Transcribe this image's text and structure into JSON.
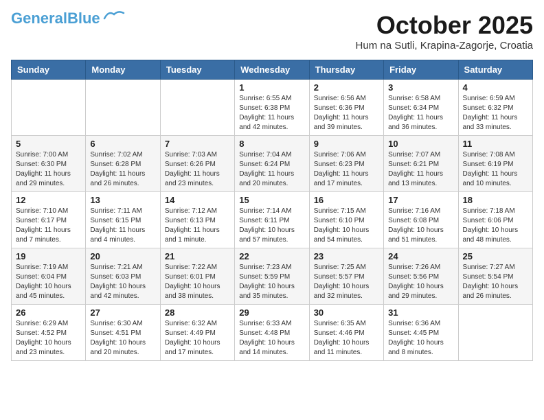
{
  "header": {
    "logo_general": "General",
    "logo_blue": "Blue",
    "month": "October 2025",
    "location": "Hum na Sutli, Krapina-Zagorje, Croatia"
  },
  "days_of_week": [
    "Sunday",
    "Monday",
    "Tuesday",
    "Wednesday",
    "Thursday",
    "Friday",
    "Saturday"
  ],
  "weeks": [
    [
      {
        "day": "",
        "info": ""
      },
      {
        "day": "",
        "info": ""
      },
      {
        "day": "",
        "info": ""
      },
      {
        "day": "1",
        "info": "Sunrise: 6:55 AM\nSunset: 6:38 PM\nDaylight: 11 hours\nand 42 minutes."
      },
      {
        "day": "2",
        "info": "Sunrise: 6:56 AM\nSunset: 6:36 PM\nDaylight: 11 hours\nand 39 minutes."
      },
      {
        "day": "3",
        "info": "Sunrise: 6:58 AM\nSunset: 6:34 PM\nDaylight: 11 hours\nand 36 minutes."
      },
      {
        "day": "4",
        "info": "Sunrise: 6:59 AM\nSunset: 6:32 PM\nDaylight: 11 hours\nand 33 minutes."
      }
    ],
    [
      {
        "day": "5",
        "info": "Sunrise: 7:00 AM\nSunset: 6:30 PM\nDaylight: 11 hours\nand 29 minutes."
      },
      {
        "day": "6",
        "info": "Sunrise: 7:02 AM\nSunset: 6:28 PM\nDaylight: 11 hours\nand 26 minutes."
      },
      {
        "day": "7",
        "info": "Sunrise: 7:03 AM\nSunset: 6:26 PM\nDaylight: 11 hours\nand 23 minutes."
      },
      {
        "day": "8",
        "info": "Sunrise: 7:04 AM\nSunset: 6:24 PM\nDaylight: 11 hours\nand 20 minutes."
      },
      {
        "day": "9",
        "info": "Sunrise: 7:06 AM\nSunset: 6:23 PM\nDaylight: 11 hours\nand 17 minutes."
      },
      {
        "day": "10",
        "info": "Sunrise: 7:07 AM\nSunset: 6:21 PM\nDaylight: 11 hours\nand 13 minutes."
      },
      {
        "day": "11",
        "info": "Sunrise: 7:08 AM\nSunset: 6:19 PM\nDaylight: 11 hours\nand 10 minutes."
      }
    ],
    [
      {
        "day": "12",
        "info": "Sunrise: 7:10 AM\nSunset: 6:17 PM\nDaylight: 11 hours\nand 7 minutes."
      },
      {
        "day": "13",
        "info": "Sunrise: 7:11 AM\nSunset: 6:15 PM\nDaylight: 11 hours\nand 4 minutes."
      },
      {
        "day": "14",
        "info": "Sunrise: 7:12 AM\nSunset: 6:13 PM\nDaylight: 11 hours\nand 1 minute."
      },
      {
        "day": "15",
        "info": "Sunrise: 7:14 AM\nSunset: 6:11 PM\nDaylight: 10 hours\nand 57 minutes."
      },
      {
        "day": "16",
        "info": "Sunrise: 7:15 AM\nSunset: 6:10 PM\nDaylight: 10 hours\nand 54 minutes."
      },
      {
        "day": "17",
        "info": "Sunrise: 7:16 AM\nSunset: 6:08 PM\nDaylight: 10 hours\nand 51 minutes."
      },
      {
        "day": "18",
        "info": "Sunrise: 7:18 AM\nSunset: 6:06 PM\nDaylight: 10 hours\nand 48 minutes."
      }
    ],
    [
      {
        "day": "19",
        "info": "Sunrise: 7:19 AM\nSunset: 6:04 PM\nDaylight: 10 hours\nand 45 minutes."
      },
      {
        "day": "20",
        "info": "Sunrise: 7:21 AM\nSunset: 6:03 PM\nDaylight: 10 hours\nand 42 minutes."
      },
      {
        "day": "21",
        "info": "Sunrise: 7:22 AM\nSunset: 6:01 PM\nDaylight: 10 hours\nand 38 minutes."
      },
      {
        "day": "22",
        "info": "Sunrise: 7:23 AM\nSunset: 5:59 PM\nDaylight: 10 hours\nand 35 minutes."
      },
      {
        "day": "23",
        "info": "Sunrise: 7:25 AM\nSunset: 5:57 PM\nDaylight: 10 hours\nand 32 minutes."
      },
      {
        "day": "24",
        "info": "Sunrise: 7:26 AM\nSunset: 5:56 PM\nDaylight: 10 hours\nand 29 minutes."
      },
      {
        "day": "25",
        "info": "Sunrise: 7:27 AM\nSunset: 5:54 PM\nDaylight: 10 hours\nand 26 minutes."
      }
    ],
    [
      {
        "day": "26",
        "info": "Sunrise: 6:29 AM\nSunset: 4:52 PM\nDaylight: 10 hours\nand 23 minutes."
      },
      {
        "day": "27",
        "info": "Sunrise: 6:30 AM\nSunset: 4:51 PM\nDaylight: 10 hours\nand 20 minutes."
      },
      {
        "day": "28",
        "info": "Sunrise: 6:32 AM\nSunset: 4:49 PM\nDaylight: 10 hours\nand 17 minutes."
      },
      {
        "day": "29",
        "info": "Sunrise: 6:33 AM\nSunset: 4:48 PM\nDaylight: 10 hours\nand 14 minutes."
      },
      {
        "day": "30",
        "info": "Sunrise: 6:35 AM\nSunset: 4:46 PM\nDaylight: 10 hours\nand 11 minutes."
      },
      {
        "day": "31",
        "info": "Sunrise: 6:36 AM\nSunset: 4:45 PM\nDaylight: 10 hours\nand 8 minutes."
      },
      {
        "day": "",
        "info": ""
      }
    ]
  ]
}
